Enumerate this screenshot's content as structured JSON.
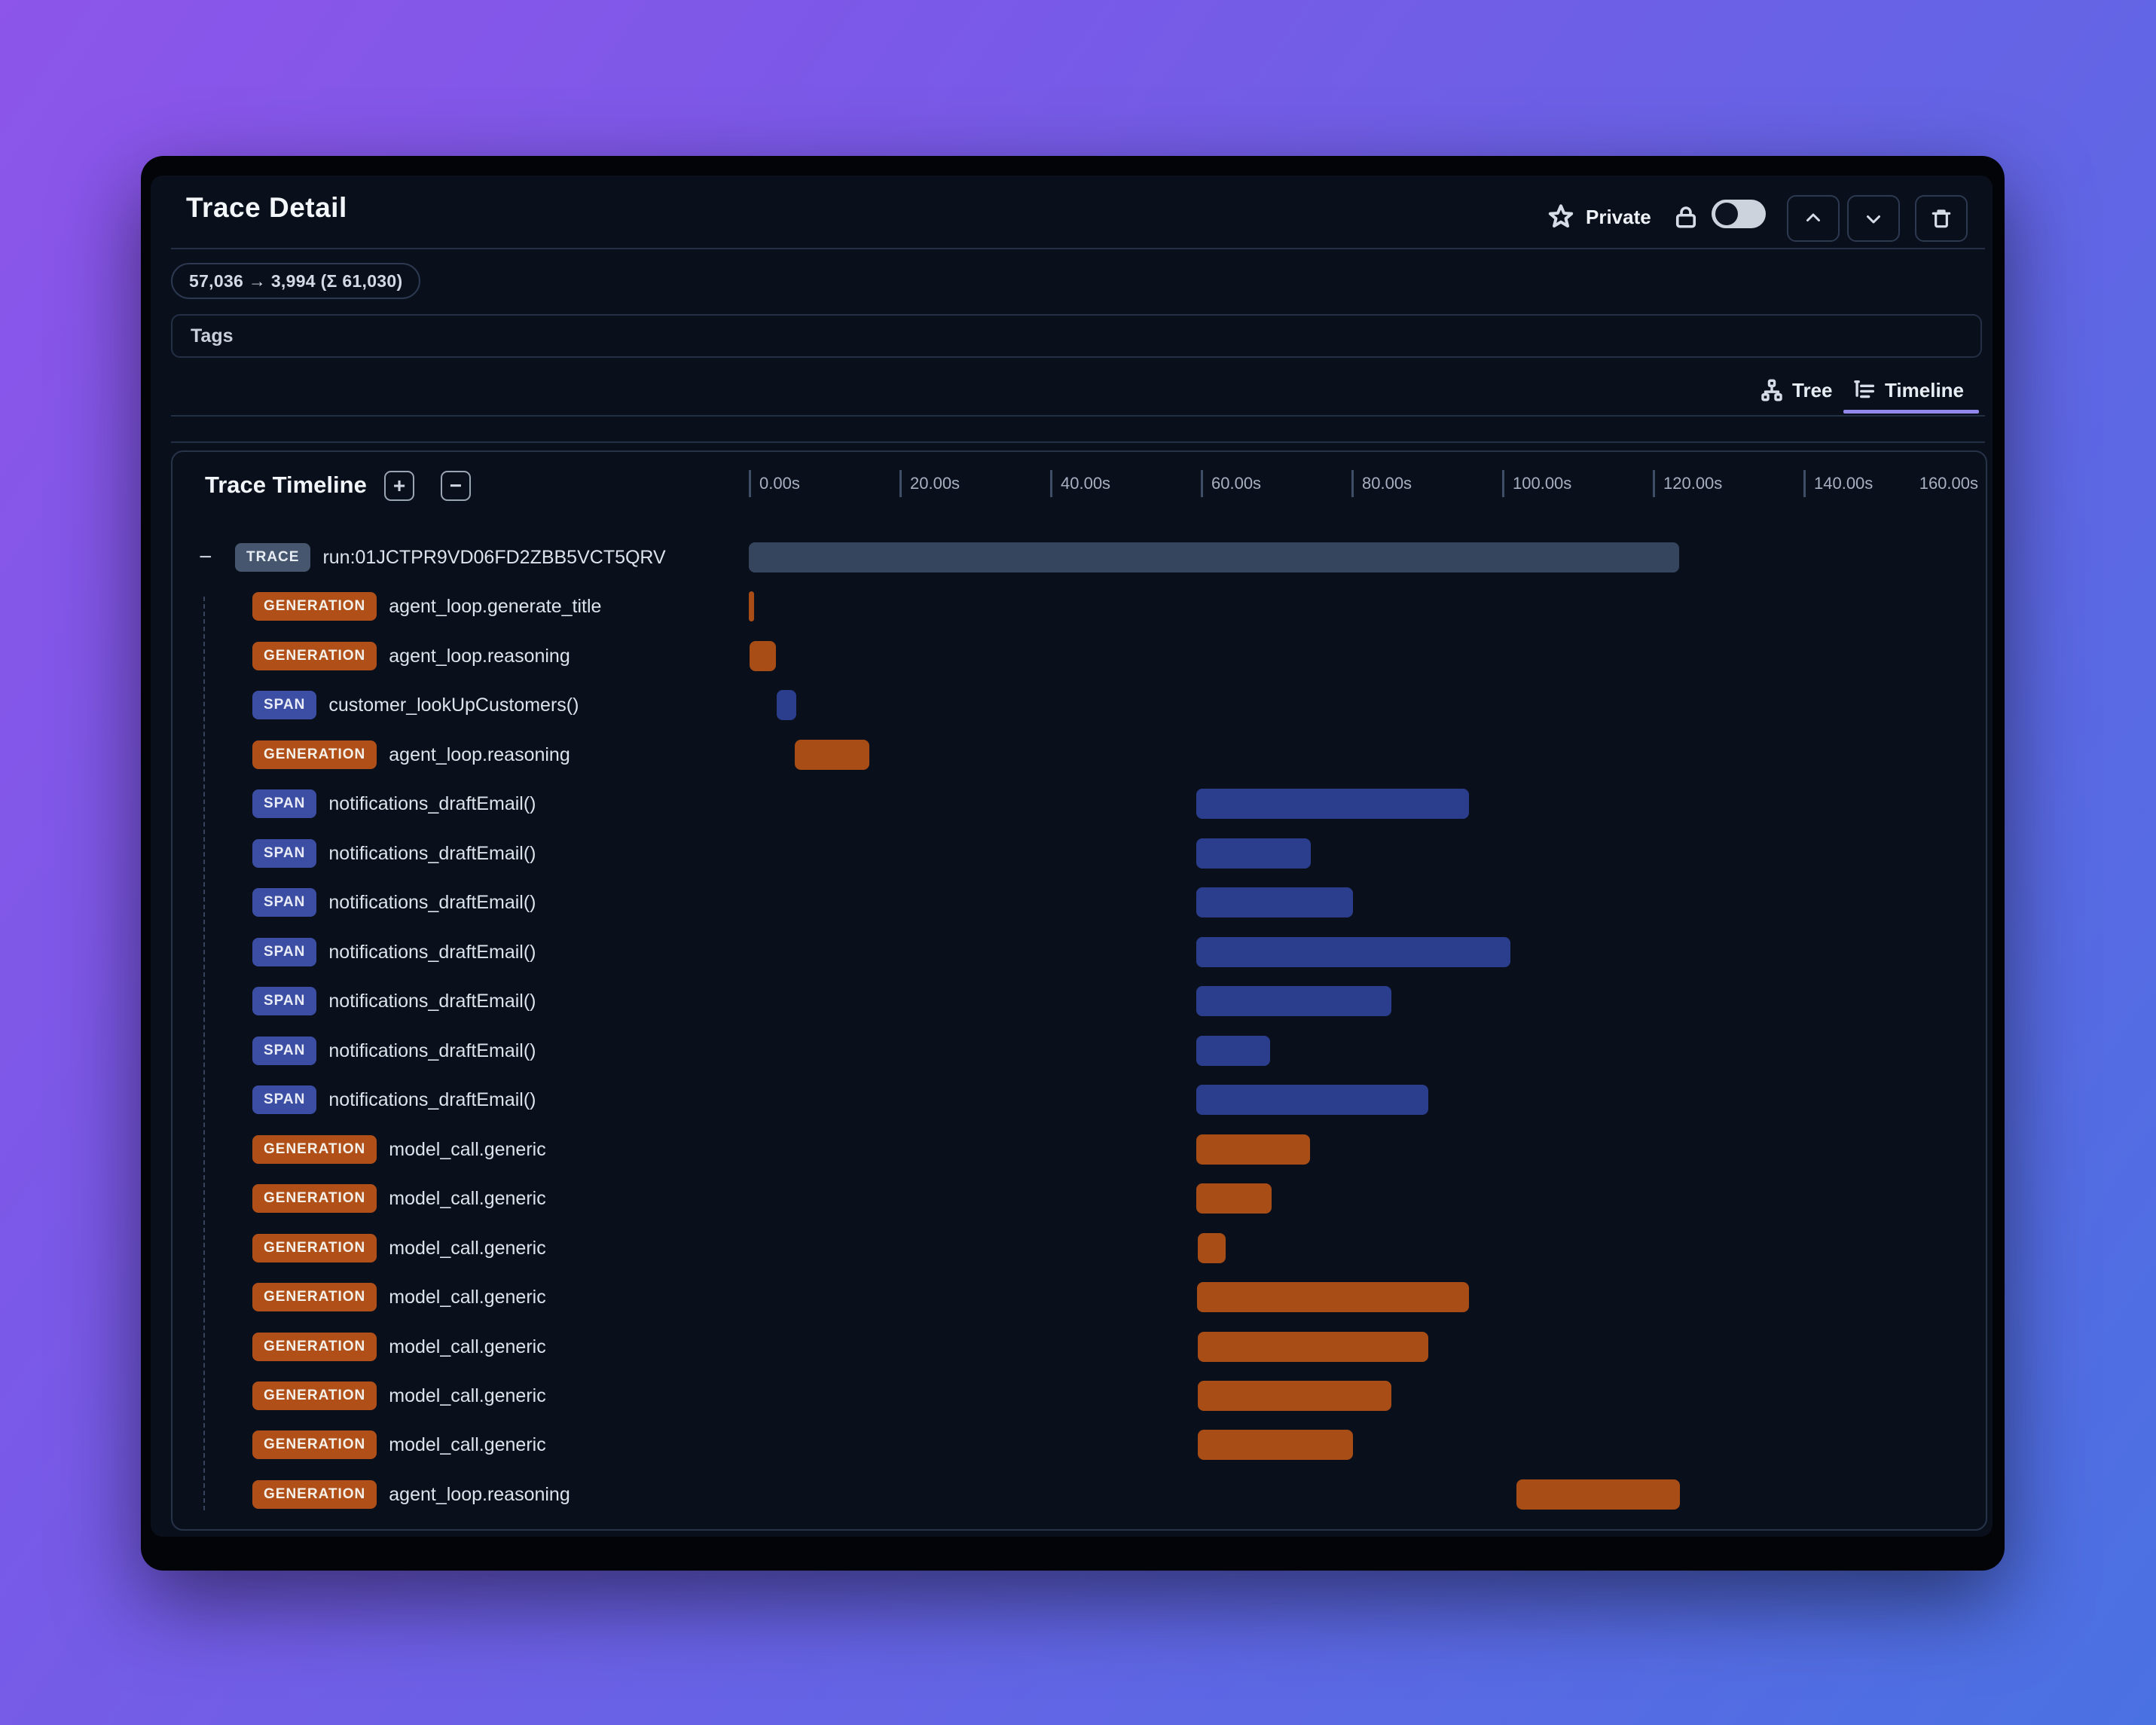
{
  "header": {
    "title": "Trace Detail",
    "privacy_label": "Private",
    "tokens_badge": "57,036 → 3,994 (Σ 61,030)",
    "tags_label": "Tags"
  },
  "tabs": [
    {
      "label": "Tree",
      "active": false
    },
    {
      "label": "Timeline",
      "active": true
    }
  ],
  "icons": [
    "star-icon",
    "lock-icon",
    "toggle-switch",
    "chevron-up-icon",
    "chevron-down-icon",
    "trash-icon",
    "tree-icon",
    "timeline-icon",
    "expand-all-icon",
    "collapse-all-icon",
    "collapse-minus-icon"
  ],
  "timeline": {
    "title": "Trace Timeline",
    "axis": {
      "ticks": [
        "0.00s",
        "20.00s",
        "40.00s",
        "60.00s",
        "80.00s",
        "100.00s",
        "120.00s",
        "140.00s"
      ],
      "end_label": "160.00s",
      "max_seconds": 160,
      "seconds_per_tick": 20
    },
    "rows": [
      {
        "type": "TRACE",
        "label": "run:01JCTPR9VD06FD2ZBB5VCT5QRV",
        "start_s": 0,
        "end_s": 123.5,
        "collapsible": true
      },
      {
        "type": "GENERATION",
        "label": "agent_loop.generate_title",
        "start_s": 0,
        "end_s": 0.7
      },
      {
        "type": "GENERATION",
        "label": "agent_loop.reasoning",
        "start_s": 0.1,
        "end_s": 3.6
      },
      {
        "type": "SPAN",
        "label": "customer_lookUpCustomers()",
        "start_s": 3.7,
        "end_s": 6.3
      },
      {
        "type": "GENERATION",
        "label": "agent_loop.reasoning",
        "start_s": 6.1,
        "end_s": 16.0
      },
      {
        "type": "SPAN",
        "label": "notifications_draftEmail()",
        "start_s": 59.4,
        "end_s": 95.6
      },
      {
        "type": "SPAN",
        "label": "notifications_draftEmail()",
        "start_s": 59.4,
        "end_s": 74.6
      },
      {
        "type": "SPAN",
        "label": "notifications_draftEmail()",
        "start_s": 59.4,
        "end_s": 80.2
      },
      {
        "type": "SPAN",
        "label": "notifications_draftEmail()",
        "start_s": 59.4,
        "end_s": 101.1
      },
      {
        "type": "SPAN",
        "label": "notifications_draftEmail()",
        "start_s": 59.4,
        "end_s": 85.3
      },
      {
        "type": "SPAN",
        "label": "notifications_draftEmail()",
        "start_s": 59.4,
        "end_s": 69.2
      },
      {
        "type": "SPAN",
        "label": "notifications_draftEmail()",
        "start_s": 59.4,
        "end_s": 90.2
      },
      {
        "type": "GENERATION",
        "label": "model_call.generic",
        "start_s": 59.4,
        "end_s": 74.5
      },
      {
        "type": "GENERATION",
        "label": "model_call.generic",
        "start_s": 59.4,
        "end_s": 69.4
      },
      {
        "type": "GENERATION",
        "label": "model_call.generic",
        "start_s": 59.6,
        "end_s": 63.3
      },
      {
        "type": "GENERATION",
        "label": "model_call.generic",
        "start_s": 59.5,
        "end_s": 95.6
      },
      {
        "type": "GENERATION",
        "label": "model_call.generic",
        "start_s": 59.6,
        "end_s": 90.2
      },
      {
        "type": "GENERATION",
        "label": "model_call.generic",
        "start_s": 59.6,
        "end_s": 85.3
      },
      {
        "type": "GENERATION",
        "label": "model_call.generic",
        "start_s": 59.6,
        "end_s": 80.2
      },
      {
        "type": "GENERATION",
        "label": "agent_loop.reasoning",
        "start_s": 101.9,
        "end_s": 123.6
      }
    ]
  },
  "colors": {
    "background_gradient_start": "#8d55ea",
    "background_gradient_end": "#4a71e2",
    "app_background": "#0a0f1c",
    "accent_active_tab": "#9287ea",
    "trace_badge": "#47566f",
    "trace_bar": "#36455e",
    "generation_badge": "#b05018",
    "generation_bar": "#a84d16",
    "span_badge": "#3b4ea3",
    "span_bar": "#2b3e8d",
    "toggle_track": "#ccd3dd"
  }
}
